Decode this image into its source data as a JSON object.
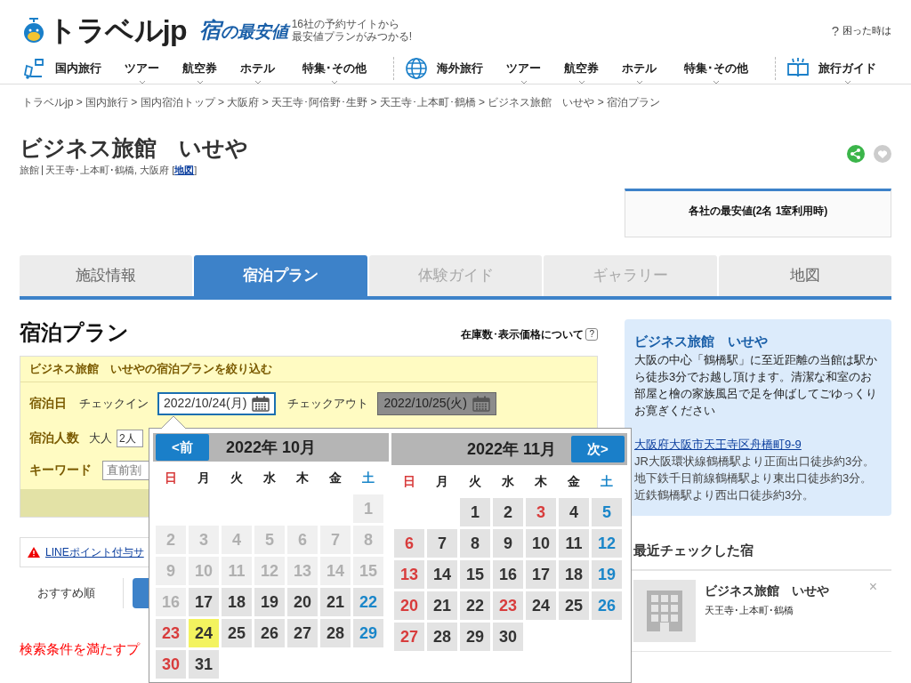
{
  "header": {
    "logo": "トラベルjp",
    "sub_logo": {
      "mark": "宿",
      "text": "の最安値"
    },
    "tagline": [
      "16社の予約サイトから",
      "最安値プランがみつかる!"
    ],
    "help_mark": "?",
    "help": "困った時は"
  },
  "nav_groups": [
    {
      "items": [
        {
          "label": "国内旅行",
          "caret": false
        },
        {
          "label": "ツアー",
          "caret": true
        },
        {
          "label": "航空券",
          "caret": true
        },
        {
          "label": "ホテル",
          "caret": true
        },
        {
          "label": "特集･その他",
          "caret": true
        }
      ]
    },
    {
      "items": [
        {
          "label": "海外旅行",
          "caret": false
        },
        {
          "label": "ツアー",
          "caret": true
        },
        {
          "label": "航空券",
          "caret": true
        },
        {
          "label": "ホテル",
          "caret": true
        },
        {
          "label": "特集･その他",
          "caret": true
        }
      ]
    },
    {
      "items": [
        {
          "label": "旅行ガイド",
          "caret": true
        }
      ]
    }
  ],
  "breadcrumb": "トラベルjp > 国内旅行 > 国内宿泊トップ > 大阪府 > 天王寺･阿倍野･生野 > 天王寺･上本町･鶴橋 > ビジネス旅館　いせや > 宿泊プラン",
  "hotel": {
    "name": "ビジネス旅館　いせや",
    "type": "旅館",
    "area": "天王寺･上本町･鶴橋, 大阪府",
    "map_brackets": [
      "[",
      "]"
    ],
    "map_link": "地図"
  },
  "price_box": {
    "title": "各社の最安値(2名 1室利用時)"
  },
  "tabs": [
    {
      "label": "施設情報",
      "selected": false,
      "disabled": false
    },
    {
      "label": "宿泊プラン",
      "selected": true,
      "disabled": false
    },
    {
      "label": "体験ガイド",
      "selected": false,
      "disabled": true
    },
    {
      "label": "ギャラリー",
      "selected": false,
      "disabled": true
    },
    {
      "label": "地図",
      "selected": false,
      "disabled": false
    }
  ],
  "plans": {
    "title": "宿泊プラン",
    "stock_note": "在庫数･表示価格について",
    "help_mark": "?"
  },
  "filter": {
    "title": "ビジネス旅館　いせやの宿泊プランを絞り込む",
    "date_label": "宿泊日",
    "checkin_label": "チェックイン",
    "checkin": "2022/10/24(月)",
    "checkout_label": "チェックアウト",
    "checkout": "2022/10/25(火)",
    "people_label": "宿泊人数",
    "adult_label": "大人",
    "adults": "2人",
    "keyword_label": "キーワード",
    "keyword_placeholder": "直前割"
  },
  "notice": {
    "link": "LINEポイント付与サ"
  },
  "sort": {
    "label": "おすすめ順"
  },
  "no_results": "検索条件を満たすプ",
  "calendar": {
    "prev": "<前",
    "next": "次>",
    "months": [
      {
        "title": "2022年 10月",
        "weekdays": [
          {
            "label": "日",
            "color": "#d83c3c"
          },
          {
            "label": "月",
            "color": "#222222"
          },
          {
            "label": "火",
            "color": "#222222"
          },
          {
            "label": "水",
            "color": "#222222"
          },
          {
            "label": "木",
            "color": "#222222"
          },
          {
            "label": "金",
            "color": "#222222"
          },
          {
            "label": "土",
            "color": "#1a86c9"
          }
        ],
        "weeks": [
          [
            {
              "kind": "blank"
            },
            {
              "kind": "blank"
            },
            {
              "kind": "blank"
            },
            {
              "kind": "blank"
            },
            {
              "kind": "blank"
            },
            {
              "kind": "blank"
            },
            {
              "kind": "past",
              "day": "1"
            }
          ],
          [
            {
              "kind": "past",
              "day": "2"
            },
            {
              "kind": "past",
              "day": "3"
            },
            {
              "kind": "past",
              "day": "4"
            },
            {
              "kind": "past",
              "day": "5"
            },
            {
              "kind": "past",
              "day": "6"
            },
            {
              "kind": "past",
              "day": "7"
            },
            {
              "kind": "past",
              "day": "8"
            }
          ],
          [
            {
              "kind": "past",
              "day": "9"
            },
            {
              "kind": "past",
              "day": "10"
            },
            {
              "kind": "past",
              "day": "11"
            },
            {
              "kind": "past",
              "day": "12"
            },
            {
              "kind": "past",
              "day": "13"
            },
            {
              "kind": "past",
              "day": "14"
            },
            {
              "kind": "past",
              "day": "15"
            }
          ],
          [
            {
              "kind": "past",
              "day": "16"
            },
            {
              "kind": "open",
              "day": "17"
            },
            {
              "kind": "open",
              "day": "18"
            },
            {
              "kind": "open",
              "day": "19"
            },
            {
              "kind": "open",
              "day": "20"
            },
            {
              "kind": "open",
              "day": "21"
            },
            {
              "kind": "open",
              "day": "22"
            }
          ],
          [
            {
              "kind": "open",
              "day": "23"
            },
            {
              "kind": "selected",
              "day": "24"
            },
            {
              "kind": "open",
              "day": "25"
            },
            {
              "kind": "open",
              "day": "26"
            },
            {
              "kind": "open",
              "day": "27"
            },
            {
              "kind": "open",
              "day": "28"
            },
            {
              "kind": "open",
              "day": "29"
            }
          ],
          [
            {
              "kind": "open",
              "day": "30"
            },
            {
              "kind": "open",
              "day": "31"
            }
          ]
        ]
      },
      {
        "title": "2022年 11月",
        "weekdays": [
          {
            "label": "日",
            "color": "#d83c3c"
          },
          {
            "label": "月",
            "color": "#222222"
          },
          {
            "label": "火",
            "color": "#222222"
          },
          {
            "label": "水",
            "color": "#222222"
          },
          {
            "label": "木",
            "color": "#222222"
          },
          {
            "label": "金",
            "color": "#222222"
          },
          {
            "label": "土",
            "color": "#1a86c9"
          }
        ],
        "weeks": [
          [
            {
              "kind": "blank"
            },
            {
              "kind": "blank"
            },
            {
              "kind": "open",
              "day": "1"
            },
            {
              "kind": "open",
              "day": "2"
            },
            {
              "kind": "holiday",
              "day": "3"
            },
            {
              "kind": "open",
              "day": "4"
            },
            {
              "kind": "open",
              "day": "5"
            }
          ],
          [
            {
              "kind": "open",
              "day": "6"
            },
            {
              "kind": "open",
              "day": "7"
            },
            {
              "kind": "open",
              "day": "8"
            },
            {
              "kind": "open",
              "day": "9"
            },
            {
              "kind": "open",
              "day": "10"
            },
            {
              "kind": "open",
              "day": "11"
            },
            {
              "kind": "open",
              "day": "12"
            }
          ],
          [
            {
              "kind": "open",
              "day": "13"
            },
            {
              "kind": "open",
              "day": "14"
            },
            {
              "kind": "open",
              "day": "15"
            },
            {
              "kind": "open",
              "day": "16"
            },
            {
              "kind": "open",
              "day": "17"
            },
            {
              "kind": "open",
              "day": "18"
            },
            {
              "kind": "open",
              "day": "19"
            }
          ],
          [
            {
              "kind": "open",
              "day": "20"
            },
            {
              "kind": "open",
              "day": "21"
            },
            {
              "kind": "open",
              "day": "22"
            },
            {
              "kind": "holiday",
              "day": "23"
            },
            {
              "kind": "open",
              "day": "24"
            },
            {
              "kind": "open",
              "day": "25"
            },
            {
              "kind": "open",
              "day": "26"
            }
          ],
          [
            {
              "kind": "open",
              "day": "27"
            },
            {
              "kind": "open",
              "day": "28"
            },
            {
              "kind": "open",
              "day": "29"
            },
            {
              "kind": "open",
              "day": "30"
            }
          ]
        ]
      }
    ]
  },
  "info": {
    "name": "ビジネス旅館　いせや",
    "description": "大阪の中心「鶴橋駅」に至近距離の当館は駅から徒歩3分でお越し頂けます。清潔な和室のお部屋と檜の家族風呂で足を伸ばしてごゆっくりお寛ぎください",
    "address": "大阪府大阪市天王寺区舟橋町9-9",
    "access": "JR大阪環状線鶴橋駅より正面出口徒歩約3分。地下鉄千日前線鶴橋駅より東出口徒歩約3分。近鉄鶴橋駅より西出口徒歩約3分。"
  },
  "recent": {
    "title": "最近チェックした宿",
    "items": [
      {
        "name": "ビジネス旅館　いせや",
        "area": "天王寺･上本町･鶴橋",
        "close": "×"
      }
    ]
  }
}
